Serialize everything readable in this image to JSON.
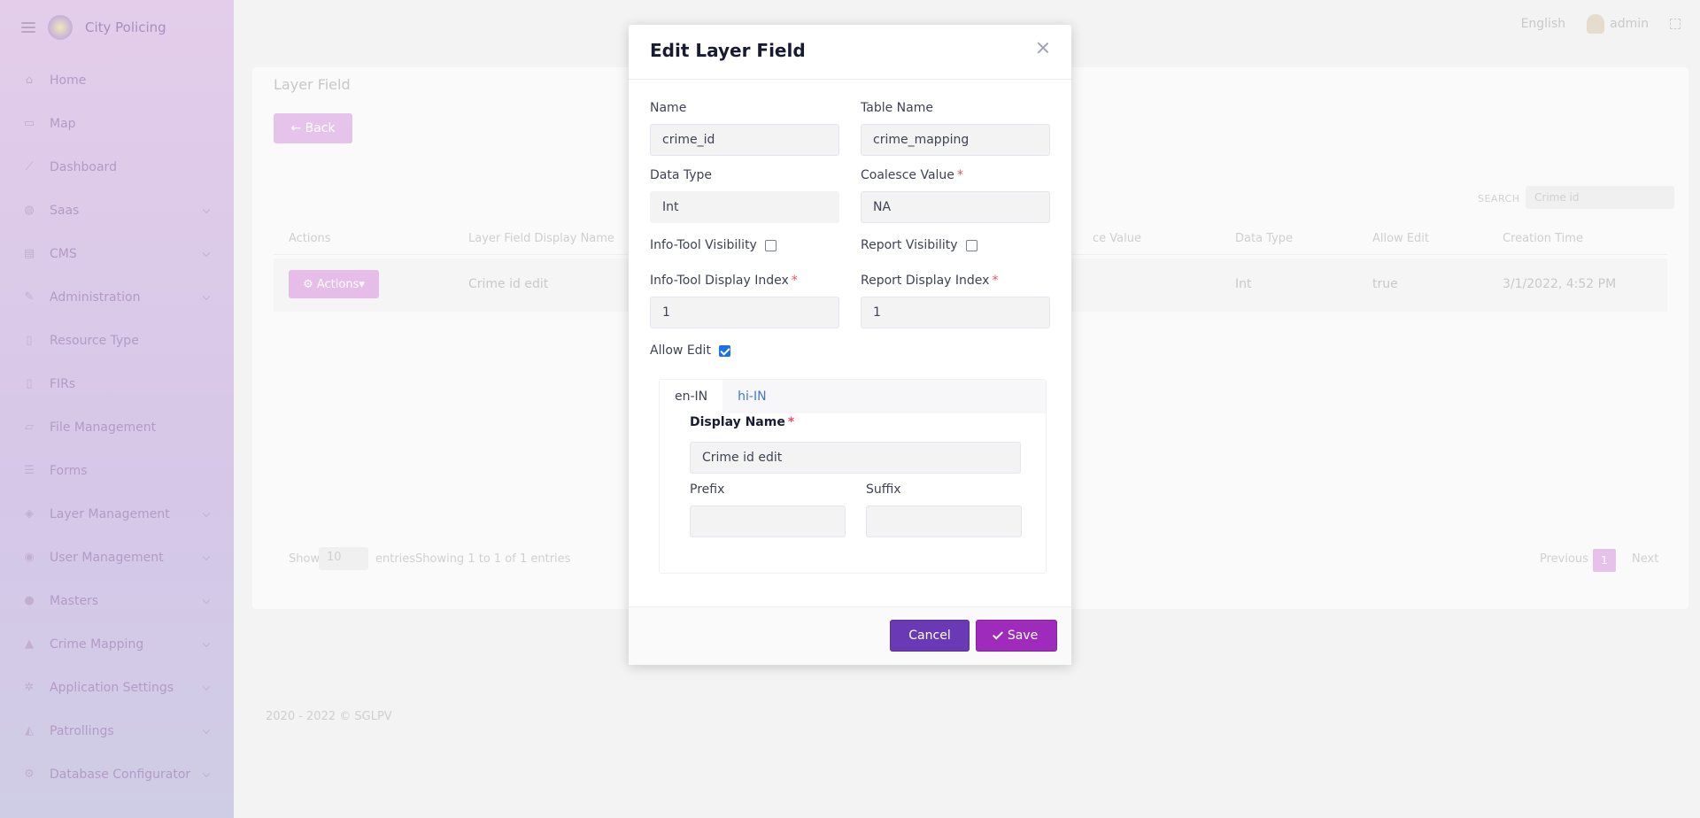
{
  "app": {
    "title": "City Policing"
  },
  "sidebar": {
    "items": [
      {
        "label": "Home",
        "icon": "home-icon",
        "has_submenu": false
      },
      {
        "label": "Map",
        "icon": "map-icon",
        "has_submenu": false
      },
      {
        "label": "Dashboard",
        "icon": "chart-icon",
        "has_submenu": false
      },
      {
        "label": "Saas",
        "icon": "globe-icon",
        "has_submenu": true
      },
      {
        "label": "CMS",
        "icon": "cms-icon",
        "has_submenu": true
      },
      {
        "label": "Administration",
        "icon": "wrench-icon",
        "has_submenu": true
      },
      {
        "label": "Resource Type",
        "icon": "file-icon",
        "has_submenu": false
      },
      {
        "label": "FIRs",
        "icon": "file-icon",
        "has_submenu": false
      },
      {
        "label": "File Management",
        "icon": "folder-icon",
        "has_submenu": false
      },
      {
        "label": "Forms",
        "icon": "list-icon",
        "has_submenu": false
      },
      {
        "label": "Layer Management",
        "icon": "layers-icon",
        "has_submenu": true
      },
      {
        "label": "User Management",
        "icon": "users-icon",
        "has_submenu": true
      },
      {
        "label": "Masters",
        "icon": "group-icon",
        "has_submenu": true
      },
      {
        "label": "Crime Mapping",
        "icon": "flask-icon",
        "has_submenu": true
      },
      {
        "label": "Application Settings",
        "icon": "cogs-icon",
        "has_submenu": true
      },
      {
        "label": "Patrollings",
        "icon": "car-icon",
        "has_submenu": true
      },
      {
        "label": "Database Configurator",
        "icon": "gear-icon",
        "has_submenu": true
      }
    ]
  },
  "topbar": {
    "language": "English",
    "user": "admin"
  },
  "page": {
    "title": "Layer Field",
    "back_label": "Back",
    "search_label": "SEARCH",
    "search_value": "Crime id",
    "table": {
      "headers": [
        "Actions",
        "Layer Field Display Name",
        "ce Value",
        "Data Type",
        "Allow Edit",
        "Creation Time"
      ],
      "row": {
        "actions_label": "Actions",
        "display_name": "Crime id edit",
        "data_type": "Int",
        "allow_edit": "true",
        "creation_time": "3/1/2022, 4:52 PM"
      }
    },
    "show_label": "Show",
    "page_size": "10",
    "entries_label": "entries",
    "showing_text": "Showing 1 to 1 of 1 entries",
    "prev_label": "Previous",
    "next_label": "Next",
    "current_page": "1",
    "copyright": "2020 - 2022 © SGLPV"
  },
  "modal": {
    "title": "Edit Layer Field",
    "name_label": "Name",
    "name_value": "crime_id",
    "table_name_label": "Table Name",
    "table_name_value": "crime_mapping",
    "data_type_label": "Data Type",
    "data_type_value": "Int",
    "coalesce_label": "Coalesce Value",
    "coalesce_value": "NA",
    "info_tool_visibility_label": "Info-Tool Visibility",
    "info_tool_visibility_checked": false,
    "report_visibility_label": "Report Visibility",
    "report_visibility_checked": false,
    "info_tool_index_label": "Info-Tool Display Index",
    "info_tool_index_value": "1",
    "report_index_label": "Report Display Index",
    "report_index_value": "1",
    "allow_edit_label": "Allow Edit",
    "allow_edit_checked": true,
    "tabs": [
      {
        "label": "en-IN",
        "active": true
      },
      {
        "label": "hi-IN",
        "active": false
      }
    ],
    "display_name_label": "Display Name",
    "display_name_value": "Crime id edit",
    "prefix_label": "Prefix",
    "prefix_value": "",
    "suffix_label": "Suffix",
    "suffix_value": "",
    "cancel_label": "Cancel",
    "save_label": "Save",
    "required_marker": "*"
  },
  "colors": {
    "cancel_button": "#6a3ab6",
    "save_button": "#9f2bbd",
    "required": "#f64e60",
    "tab_link": "#3f78ce",
    "checkbox_checked": "#1c71e8"
  }
}
